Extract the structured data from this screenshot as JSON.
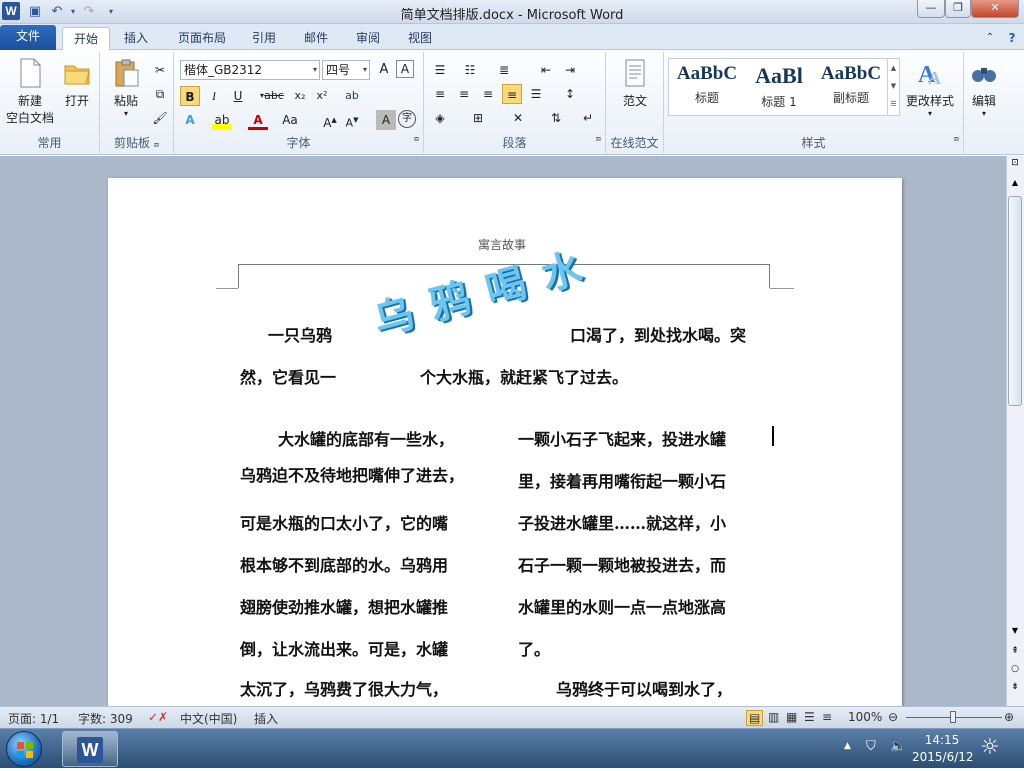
{
  "window": {
    "title": "简单文档排版.docx - Microsoft Word",
    "app_icon": "W"
  },
  "tabs": {
    "file": "文件",
    "home": "开始",
    "insert": "插入",
    "layout": "页面布局",
    "references": "引用",
    "mailings": "邮件",
    "review": "审阅",
    "view": "视图"
  },
  "groups": {
    "common": "常用",
    "clipboard": "剪贴板",
    "font": "字体",
    "paragraph": "段落",
    "online": "在线范文",
    "styles": "样式"
  },
  "buttons": {
    "new_l1": "新建",
    "new_l2": "空白文档",
    "open": "打开",
    "paste": "粘贴",
    "sample": "范文",
    "change_styles": "更改样式",
    "edit": "编辑"
  },
  "font": {
    "name": "楷体_GB2312",
    "size": "四号"
  },
  "styles": [
    {
      "preview": "AaBbC",
      "name": "标题"
    },
    {
      "preview": "AaBl",
      "name": "标题 1"
    },
    {
      "preview": "AaBbC",
      "name": "副标题"
    }
  ],
  "doc": {
    "header": "寓言故事",
    "wordart": "乌 鸦 喝 水",
    "l1a": "一只乌鸦",
    "l1b": "口渴了，到处找水喝。突",
    "l2a": "然，它看见一",
    "l2b": "个大水瓶，就赶紧飞了过去。",
    "left": [
      "大水罐的底部有一些水，",
      "乌鸦迫不及待地把嘴伸了进去，",
      "可是水瓶的口太小了，它的嘴",
      "根本够不到底部的水。乌鸦用",
      "翅膀使劲推水罐，想把水罐推",
      "倒，让水流出来。可是，水罐",
      "太沉了，乌鸦费了很大力气，"
    ],
    "right": [
      "一颗小石子飞起来，投进水罐",
      "里，接着再用嘴衔起一颗小石",
      "子投进水罐里……就这样，小",
      "石子一颗一颗地被投进去，而",
      "水罐里的水则一点一点地涨高",
      "了。",
      ""
    ],
    "last_right": "乌鸦终于可以喝到水了，"
  },
  "status": {
    "page": "页面: 1/1",
    "words": "字数: 309",
    "lang": "中文(中国)",
    "mode": "插入",
    "zoom": "100%"
  },
  "taskbar": {
    "time": "14:15",
    "date": "2015/6/12"
  }
}
